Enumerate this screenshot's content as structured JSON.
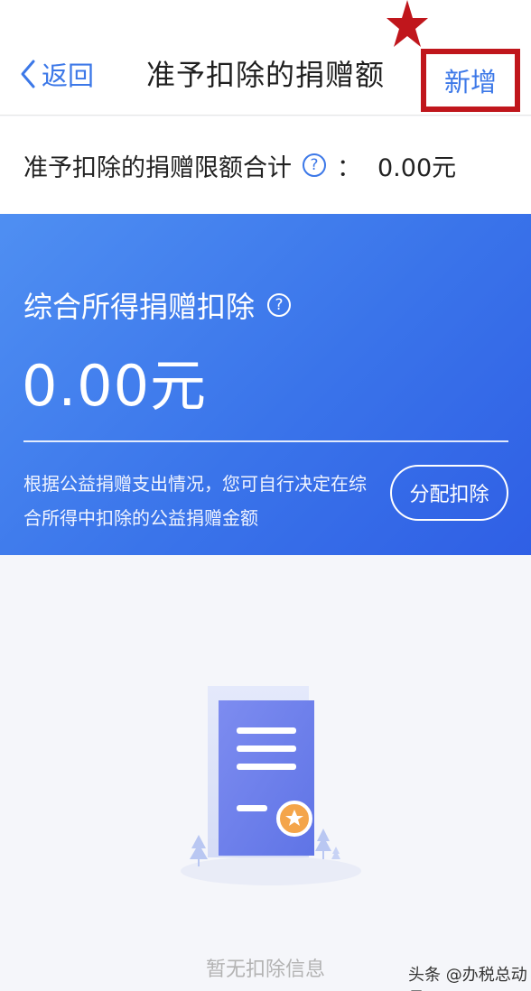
{
  "nav": {
    "back_label": "返回",
    "title": "准予扣除的捐赠额",
    "add_label": "新增"
  },
  "limit": {
    "label": "准予扣除的捐赠限额合计",
    "help_glyph": "?",
    "colon": "：",
    "value": "0.00元"
  },
  "card": {
    "title": "综合所得捐赠扣除",
    "help_glyph": "?",
    "amount": "0.00元",
    "description": "根据公益捐赠支出情况，您可自行决定在综合所得中扣除的公益捐赠金额",
    "button_label": "分配扣除"
  },
  "empty": {
    "text": "暂无扣除信息"
  },
  "watermark": "头条 @办税总动员",
  "colors": {
    "accent": "#3c78e8",
    "highlight": "#c0161c",
    "card_gradient_start": "#4f8ff2",
    "card_gradient_end": "#2f5fe5"
  },
  "icons": {
    "back": "chevron-left-icon",
    "help": "question-circle-icon",
    "annotation": "star-icon",
    "empty": "document-certificate-icon"
  }
}
